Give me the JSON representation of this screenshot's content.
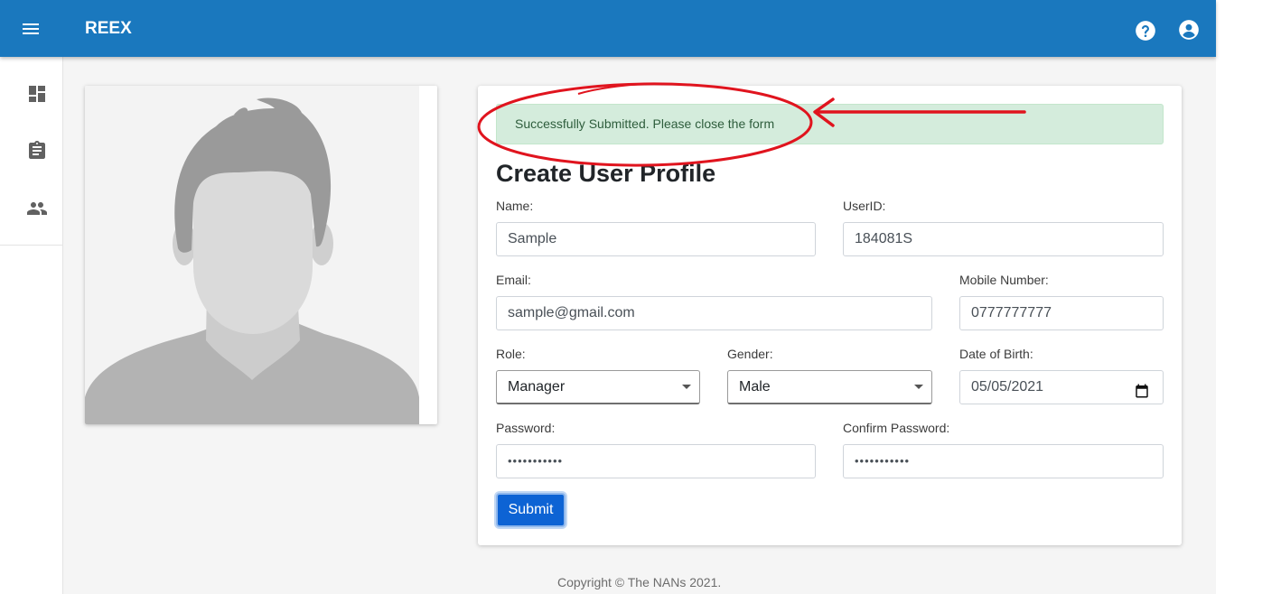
{
  "app": {
    "title": "REEX",
    "brand_color": "#1a78be"
  },
  "header": {
    "menu_icon": "menu-icon",
    "help_icon": "help-circle-icon",
    "account_icon": "account-circle-icon"
  },
  "sidebar": {
    "items": [
      {
        "name": "dashboard",
        "icon": "dashboard-icon"
      },
      {
        "name": "assignment",
        "icon": "clipboard-icon"
      },
      {
        "name": "users",
        "icon": "people-icon"
      }
    ]
  },
  "avatar": {
    "icon": "default-user-avatar"
  },
  "form": {
    "alert": "Successfully Submitted. Please close the form",
    "title": "Create User Profile",
    "name_label": "Name:",
    "name_value": "Sample",
    "userid_label": "UserID:",
    "userid_value": "184081S",
    "email_label": "Email:",
    "email_value": "sample@gmail.com",
    "mobile_label": "Mobile Number:",
    "mobile_value": "0777777777",
    "role_label": "Role:",
    "role_value": "Manager",
    "gender_label": "Gender:",
    "gender_value": "Male",
    "dob_label": "Date of Birth:",
    "dob_value": "05/05/2021",
    "password_label": "Password:",
    "password_value": "•••••••••••",
    "confirm_label": "Confirm Password:",
    "confirm_value": "•••••••••••",
    "submit_label": "Submit"
  },
  "footer": {
    "text": "Copyright © The NANs 2021."
  },
  "annotation": {
    "color": "#e0141e"
  }
}
